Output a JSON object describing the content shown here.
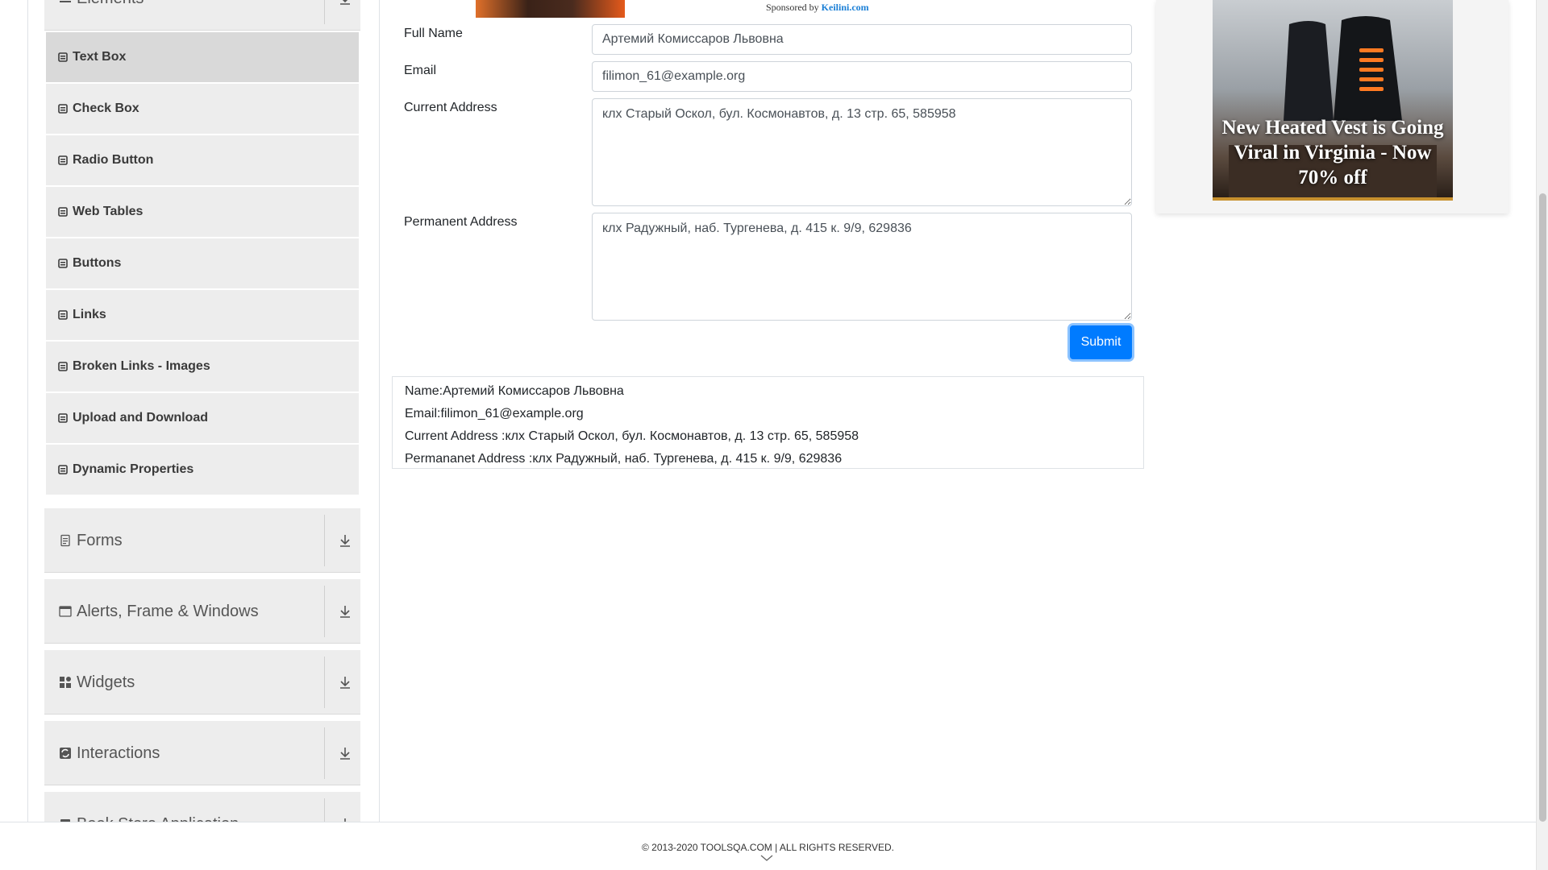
{
  "sidebar": {
    "elements_header": "Elements",
    "items": [
      {
        "label": "Text Box",
        "active": true
      },
      {
        "label": "Check Box"
      },
      {
        "label": "Radio Button"
      },
      {
        "label": "Web Tables"
      },
      {
        "label": "Buttons"
      },
      {
        "label": "Links"
      },
      {
        "label": "Broken Links - Images"
      },
      {
        "label": "Upload and Download"
      },
      {
        "label": "Dynamic Properties"
      }
    ],
    "groups": [
      {
        "label": "Forms",
        "icon": "document-icon"
      },
      {
        "label": "Alerts, Frame & Windows",
        "icon": "window-icon"
      },
      {
        "label": "Widgets",
        "icon": "widgets-icon"
      },
      {
        "label": "Interactions",
        "icon": "interactions-icon"
      },
      {
        "label": "Book Store Application",
        "icon": "book-icon"
      }
    ]
  },
  "ad_top": {
    "sponsored_prefix": "Sponsored by ",
    "sponsor": "Keilini.com"
  },
  "form": {
    "full_name_label": "Full Name",
    "full_name_value": "Артемий Комиссаров Львовна",
    "email_label": "Email",
    "email_value": "filimon_61@example.org",
    "current_address_label": "Current Address",
    "current_address_value": "клх Старый Оскол, бул. Космонавтов, д. 13 стр. 65, 585958",
    "permanent_address_label": "Permanent Address",
    "permanent_address_value": "клх Радужный, наб. Тургенева, д. 415 к. 9/9, 629836",
    "submit_label": "Submit"
  },
  "output": {
    "name": "Name:Артемий Комиссаров Львовна",
    "email": "Email:filimon_61@example.org",
    "current_address": "Current Address :клх Старый Оскол, бул. Космонавтов, д. 13 стр. 65, 585958",
    "permanent_address": "Permananet Address :клх Радужный, наб. Тургенева, д. 415 к. 9/9, 629836"
  },
  "ad_right": {
    "headline": "New Heated Vest is Going Viral in Virginia - Now 70% off"
  },
  "footer": {
    "copyright": "© 2013-2020 TOOLSQA.COM | ALL RIGHTS RESERVED."
  },
  "colors": {
    "primary": "#007bff",
    "sidebar_bg": "#ededed",
    "sidebar_active": "#d9d9d9",
    "sponsor_link": "#1a7fd6"
  }
}
